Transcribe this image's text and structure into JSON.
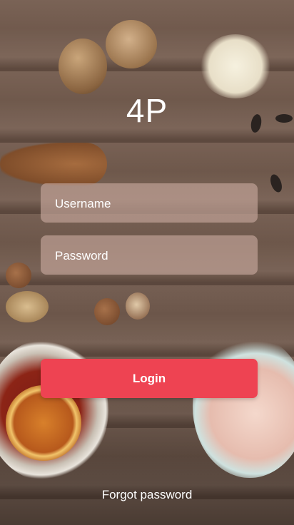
{
  "app": {
    "title": "4P"
  },
  "login_form": {
    "username_placeholder": "Username",
    "password_placeholder": "Password",
    "login_label": "Login",
    "forgot_label": "Forgot password"
  },
  "colors": {
    "accent": "#ee4352",
    "field_bg": "#bea094"
  }
}
